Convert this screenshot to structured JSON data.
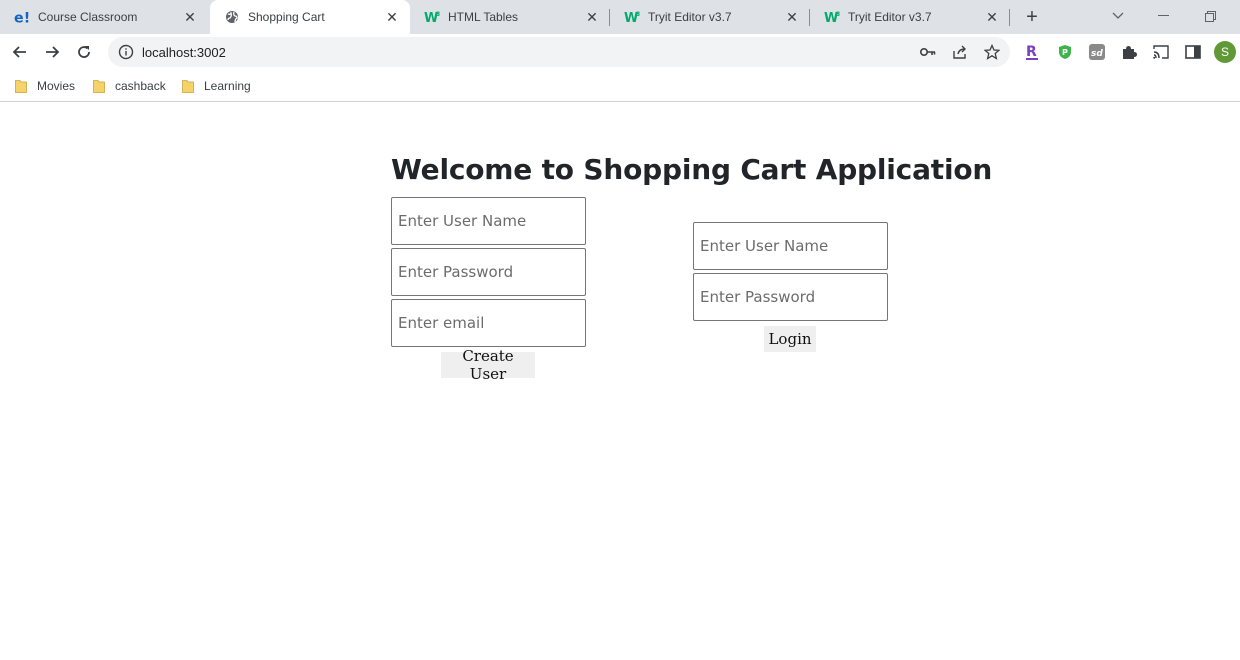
{
  "browser": {
    "tabs": [
      {
        "title": "Course Classroom",
        "icon": "edureka-icon",
        "active": false
      },
      {
        "title": "Shopping Cart",
        "icon": "globe-icon",
        "active": true
      },
      {
        "title": "HTML Tables",
        "icon": "w3schools-icon",
        "active": false
      },
      {
        "title": "Tryit Editor v3.7",
        "icon": "w3schools-icon",
        "active": false
      },
      {
        "title": "Tryit Editor v3.7",
        "icon": "w3schools-icon",
        "active": false
      }
    ],
    "url": "localhost:3002",
    "profile_initial": "S",
    "bookmarks": [
      "Movies",
      "cashback",
      "Learning"
    ],
    "colors": {
      "accent": "#1a73e8",
      "profile": "#5f9a37",
      "folder": "#f5d36a"
    }
  },
  "page": {
    "title": "Welcome to Shopping Cart Application",
    "register": {
      "username_placeholder": "Enter User Name",
      "password_placeholder": "Enter Password",
      "email_placeholder": "Enter email",
      "button_label": "Create User"
    },
    "login": {
      "username_placeholder": "Enter User Name",
      "password_placeholder": "Enter Password",
      "button_label": "Login"
    }
  }
}
